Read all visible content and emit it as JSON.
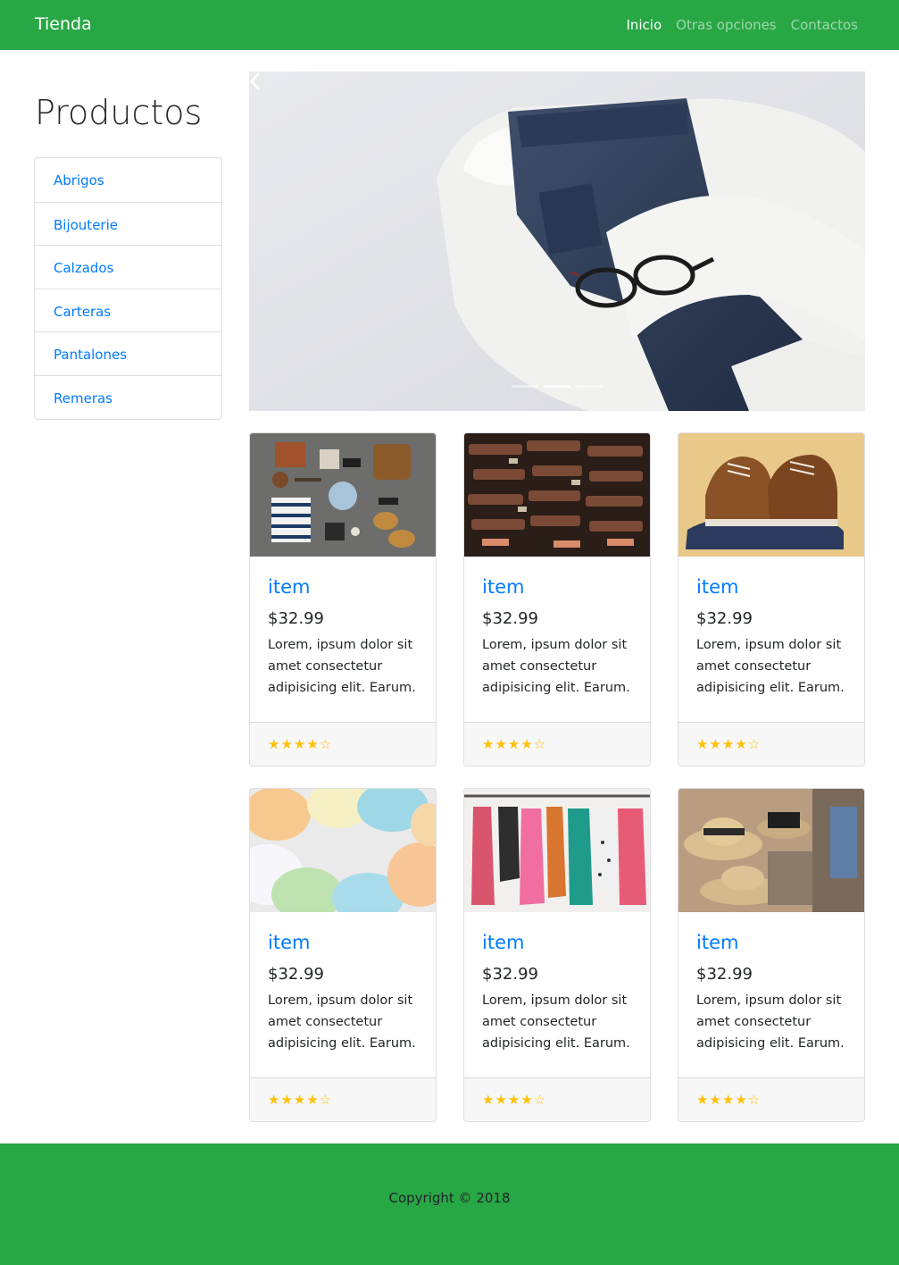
{
  "navbar": {
    "brand": "Tienda",
    "links": [
      {
        "label": "Inicio",
        "active": true
      },
      {
        "label": "Otras opciones",
        "active": false
      },
      {
        "label": "Contactos",
        "active": false
      }
    ],
    "color": "#28a745"
  },
  "sidebar": {
    "title": "Productos",
    "items": [
      {
        "label": "Abrigos"
      },
      {
        "label": "Bijouterie"
      },
      {
        "label": "Calzados"
      },
      {
        "label": "Carteras"
      },
      {
        "label": "Pantalones"
      },
      {
        "label": "Remeras"
      }
    ]
  },
  "carousel": {
    "prev_icon": "chevron-left-icon",
    "slides": 3,
    "active_slide": 2
  },
  "products": [
    {
      "title": "item",
      "price": "$32.99",
      "description": "Lorem, ipsum dolor sit amet consectetur adipisicing elit. Earum.",
      "rating": "★★★★☆"
    },
    {
      "title": "item",
      "price": "$32.99",
      "description": "Lorem, ipsum dolor sit amet consectetur adipisicing elit. Earum.",
      "rating": "★★★★☆"
    },
    {
      "title": "item",
      "price": "$32.99",
      "description": "Lorem, ipsum dolor sit amet consectetur adipisicing elit. Earum.",
      "rating": "★★★★☆"
    },
    {
      "title": "item",
      "price": "$32.99",
      "description": "Lorem, ipsum dolor sit amet consectetur adipisicing elit. Earum.",
      "rating": "★★★★☆"
    },
    {
      "title": "item",
      "price": "$32.99",
      "description": "Lorem, ipsum dolor sit amet consectetur adipisicing elit. Earum.",
      "rating": "★★★★☆"
    },
    {
      "title": "item",
      "price": "$32.99",
      "description": "Lorem, ipsum dolor sit amet consectetur adipisicing elit. Earum.",
      "rating": "★★★★☆"
    }
  ],
  "footer": {
    "copyright": "Copyright © 2018"
  },
  "colors": {
    "accent": "#28a745",
    "link": "#007bff",
    "star": "#ffc107"
  }
}
